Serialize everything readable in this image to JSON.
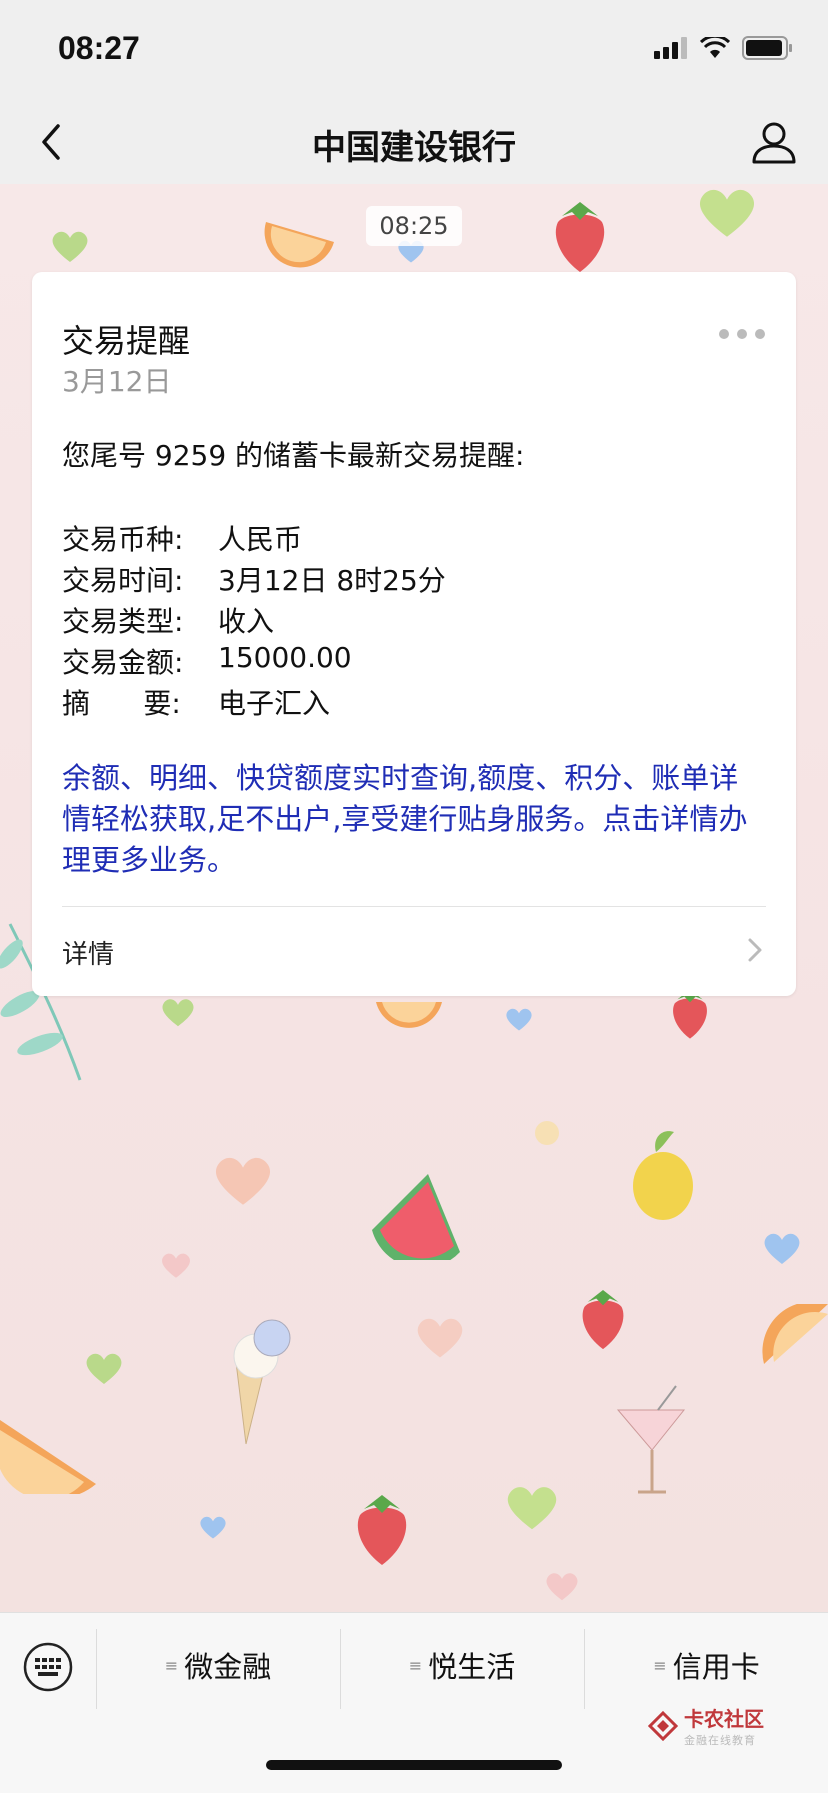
{
  "status_bar": {
    "time": "08:27"
  },
  "nav": {
    "title": "中国建设银行"
  },
  "chat": {
    "timestamp": "08:25"
  },
  "card": {
    "title": "交易提醒",
    "date": "3月12日",
    "intro": "您尾号 9259 的储蓄卡最新交易提醒:",
    "fields": [
      {
        "label": "交易币种:",
        "value": "人民币"
      },
      {
        "label": "交易时间:",
        "value": "3月12日 8时25分"
      },
      {
        "label": "交易类型:",
        "value": "收入"
      },
      {
        "label": "交易金额:",
        "value": "15000.00"
      },
      {
        "label": "摘      要:",
        "value": "电子汇入"
      }
    ],
    "promo": "余额、明细、快贷额度实时查询,额度、积分、账单详情轻松获取,足不出户,享受建行贴身服务。点击详情办理更多业务。",
    "details_label": "详情"
  },
  "menu": {
    "items": [
      {
        "label": "微金融"
      },
      {
        "label": "悦生活"
      },
      {
        "label": "信用卡"
      }
    ]
  },
  "watermark": {
    "main": "卡农社区",
    "sub": "金融在线教育"
  },
  "colors": {
    "promo_text": "#1f2db5",
    "accent_red": "#c0383b"
  }
}
